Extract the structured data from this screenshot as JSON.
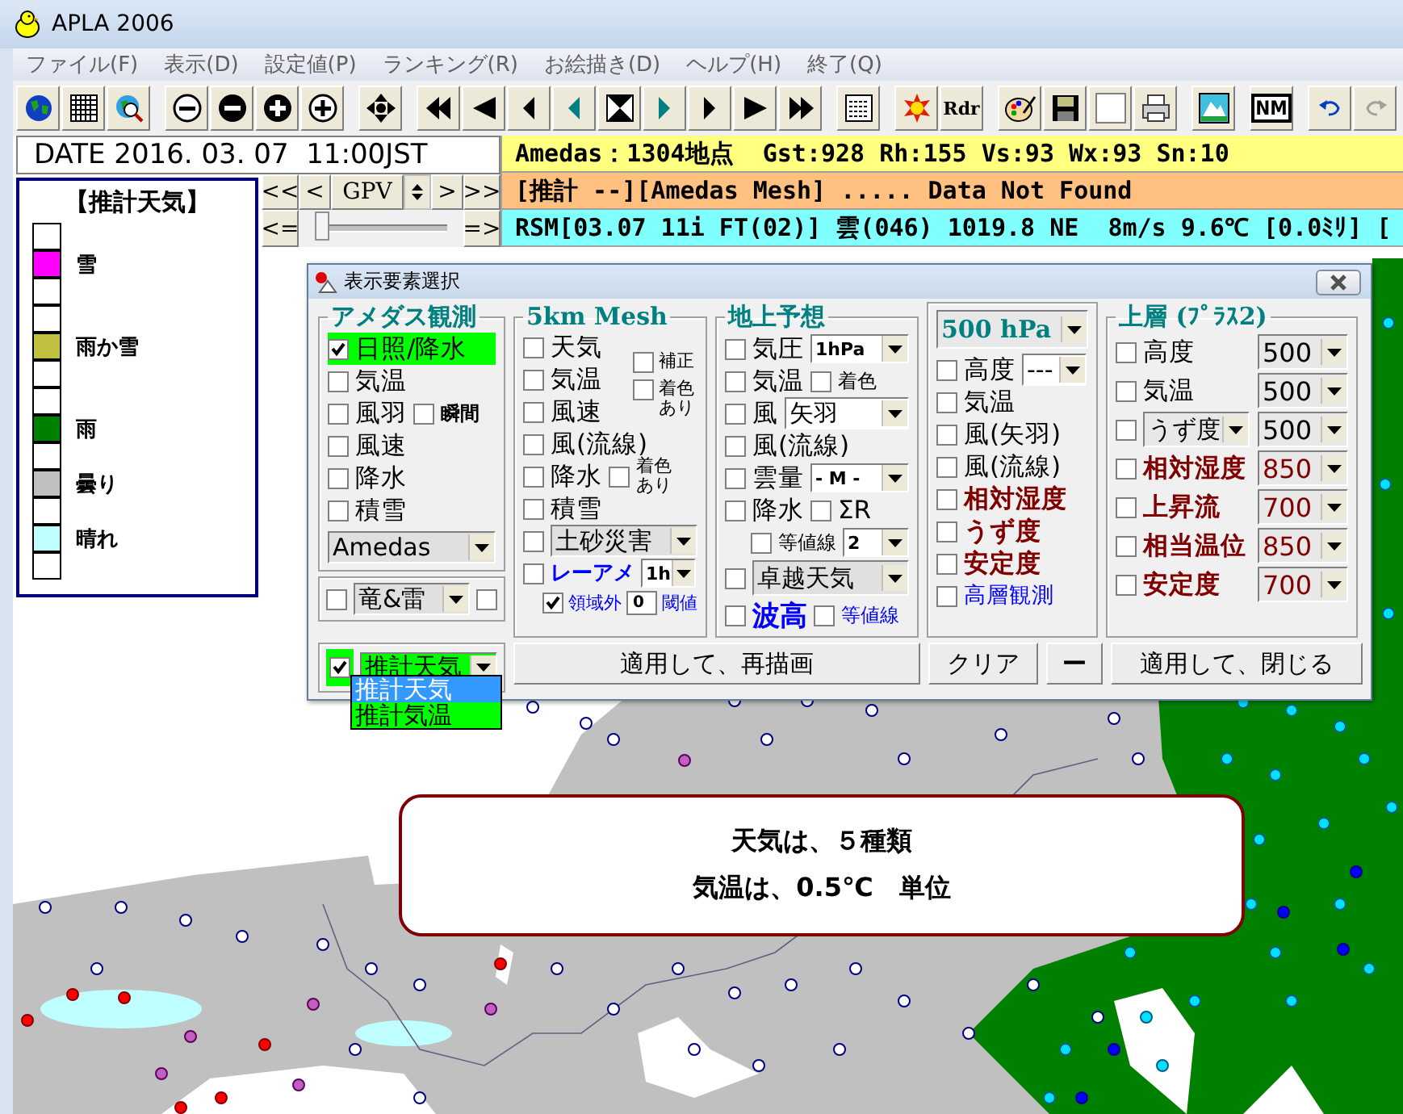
{
  "window": {
    "title": "APLA 2006"
  },
  "menu": [
    "ファイル(F)",
    "表示(D)",
    "設定値(P)",
    "ランキング(R)",
    "お絵描き(D)",
    "ヘルプ(H)",
    "終了(Q)"
  ],
  "toolbar": {
    "radar_label": "Rdr",
    "nm_label": "NM"
  },
  "date": "DATE 2016. 03. 07  11:00JST",
  "status_lines": [
    {
      "text": "Amedas：1304地点  Gst:928 Rh:155 Vs:93 Wx:93 Sn:10",
      "color": "#ffff80"
    },
    {
      "text": "[推計 --][Amedas Mesh] ..... Data Not Found",
      "color": "#ffc080"
    },
    {
      "text": "RSM[03.07 11i FT(02)] 雲(046) 1019.8 NE  8m/s 9.6℃ [0.0ﾐﾘ] [",
      "color": "#80ffff"
    }
  ],
  "gpv": {
    "first": "<<",
    "prev": "<",
    "label": "GPV",
    "next": ">",
    "last": ">>",
    "back": "<=",
    "forward": "=>",
    "slider": {
      "level": 0.05
    }
  },
  "legend": {
    "title": "【推計天気】",
    "items": [
      {
        "color": "#ffffff"
      },
      {
        "color": "#ff00ff",
        "label": "雪"
      },
      {
        "color": "#ffffff"
      },
      {
        "color": "#ffffff"
      },
      {
        "color": "#c0c040",
        "label": "雨か雪"
      },
      {
        "color": "#ffffff"
      },
      {
        "color": "#ffffff"
      },
      {
        "color": "#008000",
        "label": "雨"
      },
      {
        "color": "#ffffff"
      },
      {
        "color": "#c0c0c0",
        "label": "曇り"
      },
      {
        "color": "#ffffff"
      },
      {
        "color": "#c0ffff",
        "label": "晴れ"
      },
      {
        "color": "#ffffff"
      }
    ]
  },
  "dialog": {
    "title": "表示要素選択",
    "amedas": {
      "title": "アメダス観測",
      "source": "Amedas",
      "items": [
        {
          "label": "日照/降水",
          "checked": true,
          "highlighted": true
        },
        {
          "label": "気温",
          "checked": false,
          "highlighted": false
        },
        {
          "label": "風羽",
          "checked": false,
          "highlighted": false,
          "option": {
            "label": "瞬間",
            "checked": false
          }
        },
        {
          "label": "風速",
          "checked": false,
          "highlighted": false
        },
        {
          "label": "降水",
          "checked": false,
          "highlighted": false
        },
        {
          "label": "積雪",
          "checked": false,
          "highlighted": false
        }
      ]
    },
    "lightning": {
      "checked": false,
      "select": "竜&雷",
      "option_checked": false
    },
    "estimate": {
      "checked": true,
      "highlighted": true,
      "select": "推計天気",
      "options": [
        {
          "label": "推計天気",
          "selected": true
        },
        {
          "label": "推計気温",
          "selected": false
        }
      ]
    },
    "mesh": {
      "title": "5km Mesh",
      "items": [
        {
          "label": "天気",
          "checked": false
        },
        {
          "label": "気温",
          "checked": false
        },
        {
          "label": "風速",
          "checked": false
        },
        {
          "label": "風(流線)",
          "checked": false
        },
        {
          "label": "降水",
          "checked": false,
          "option": {
            "label": "着色あり",
            "checked": false
          }
        },
        {
          "label": "積雪",
          "checked": false
        }
      ],
      "side_options": [
        {
          "label": "補正",
          "checked": false
        },
        {
          "label": "着色あり",
          "checked": false
        }
      ],
      "disaster": {
        "checked": false,
        "select": "土砂災害"
      },
      "radar": {
        "checked": false,
        "label": "レーアメ",
        "select": "1h"
      },
      "outside": {
        "checked": true,
        "label": "領域外",
        "value": "0",
        "threshold_label": "閾値"
      }
    },
    "ground": {
      "title": "地上予想",
      "items": [
        {
          "label": "気圧",
          "checked": false,
          "select": "1hPa"
        },
        {
          "label": "気温",
          "checked": false,
          "option": {
            "label": "着色",
            "checked": false
          }
        },
        {
          "label": "風",
          "checked": false,
          "select": "矢羽"
        },
        {
          "label": "風(流線)",
          "checked": false
        },
        {
          "label": "雲量",
          "checked": false,
          "select": "- M -"
        },
        {
          "label": "降水",
          "checked": false,
          "option": {
            "label": "ΣR",
            "checked": false
          }
        }
      ],
      "contour": {
        "checked": false,
        "label": "等値線",
        "select": "2"
      },
      "dominant": {
        "checked": false,
        "select": "卓越天気"
      },
      "wave": {
        "checked": false,
        "label": "波高",
        "option": {
          "label": "等値線",
          "checked": false
        }
      }
    },
    "level500": {
      "select": "500 hPa",
      "items": [
        {
          "label": "高度",
          "checked": false,
          "select": "---"
        },
        {
          "label": "気温",
          "checked": false
        },
        {
          "label": "風(矢羽)",
          "checked": false
        },
        {
          "label": "風(流線)",
          "checked": false
        },
        {
          "label": "相対湿度",
          "checked": false,
          "color": "#800000"
        },
        {
          "label": "うず度",
          "checked": false,
          "color": "#800000"
        },
        {
          "label": "安定度",
          "checked": false,
          "color": "#800000"
        },
        {
          "label": "高層観測",
          "checked": false,
          "color": "#0000ff"
        }
      ]
    },
    "upper": {
      "title": "上層 (ﾌﾟﾗｽ2)",
      "items": [
        {
          "label": "高度",
          "checked": false,
          "pressure": "500"
        },
        {
          "label": "気温",
          "checked": false,
          "pressure": "500"
        },
        {
          "select": "うず度",
          "checked": false,
          "pressure": "500"
        },
        {
          "label": "相対湿度",
          "checked": false,
          "pressure": "850",
          "color": "#800000"
        },
        {
          "label": "上昇流",
          "checked": false,
          "pressure": "700",
          "color": "#800000"
        },
        {
          "label": "相当温位",
          "checked": false,
          "pressure": "850",
          "color": "#800000"
        },
        {
          "label": "安定度",
          "checked": false,
          "pressure": "700",
          "color": "#800000"
        }
      ]
    },
    "buttons": {
      "redraw": "適用して、再描画",
      "clear": "クリア",
      "minimize": "ー",
      "apply_close": "適用して、閉じる"
    }
  },
  "message": {
    "lines": [
      "天気は、５種類",
      "気温は、0.5℃　単位"
    ]
  }
}
